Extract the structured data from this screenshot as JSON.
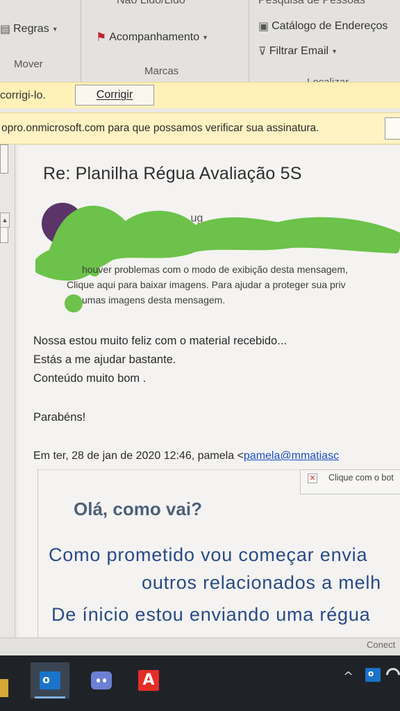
{
  "ribbon": {
    "top_cut_left": "Não Lido/Lido",
    "top_cut_right": "Pesquisa de Pessoas",
    "rules_label": "Regras",
    "followup_label": "Acompanhamento",
    "address_book_label": "Catálogo de Endereços",
    "filter_email_label": "Filtrar Email",
    "groups": {
      "move": "Mover",
      "tags": "Marcas",
      "find": "Localizar"
    }
  },
  "infobar_correct": {
    "text": "corrigi-lo.",
    "button_label": "Corrigir"
  },
  "infobar_verify": {
    "text": "opro.onmicrosoft.com para que possamos verificar sua assinatura."
  },
  "message": {
    "subject": "Re: Planilha Régua Avaliação 5S",
    "warning_lines": [
      "houver problemas com o modo de exibição desta mensagem,",
      "Clique aqui para baixar imagens. Para ajudar a proteger sua priv",
      "umas imagens desta mensagem."
    ],
    "body_lines": [
      "Nossa estou muito feliz com o material recebido...",
      "Estás a me ajudar bastante.",
      "Conteúdo muito bom .",
      "Parabéns!"
    ],
    "quoted_header_prefix": "Em ter, 28 de jan de 2020 12:46, pamela <",
    "quoted_header_email": "pamela@mmatiasc",
    "broken_image_caption": "Clique com o bot",
    "quoted_greeting": "Olá, como vai?",
    "quoted_lines": [
      "Como prometido vou começar envia",
      "outros relacionados a melh",
      "De ínicio estou enviando uma régua"
    ]
  },
  "status": {
    "connection": "Conect"
  },
  "taskbar": {
    "apps": [
      {
        "name": "Outlook",
        "icon": "outlook-icon",
        "active": true
      },
      {
        "name": "Discord",
        "icon": "discord-icon",
        "active": false
      },
      {
        "name": "Acrobat",
        "icon": "acrobat-icon",
        "active": false,
        "glyph": "A"
      }
    ]
  }
}
